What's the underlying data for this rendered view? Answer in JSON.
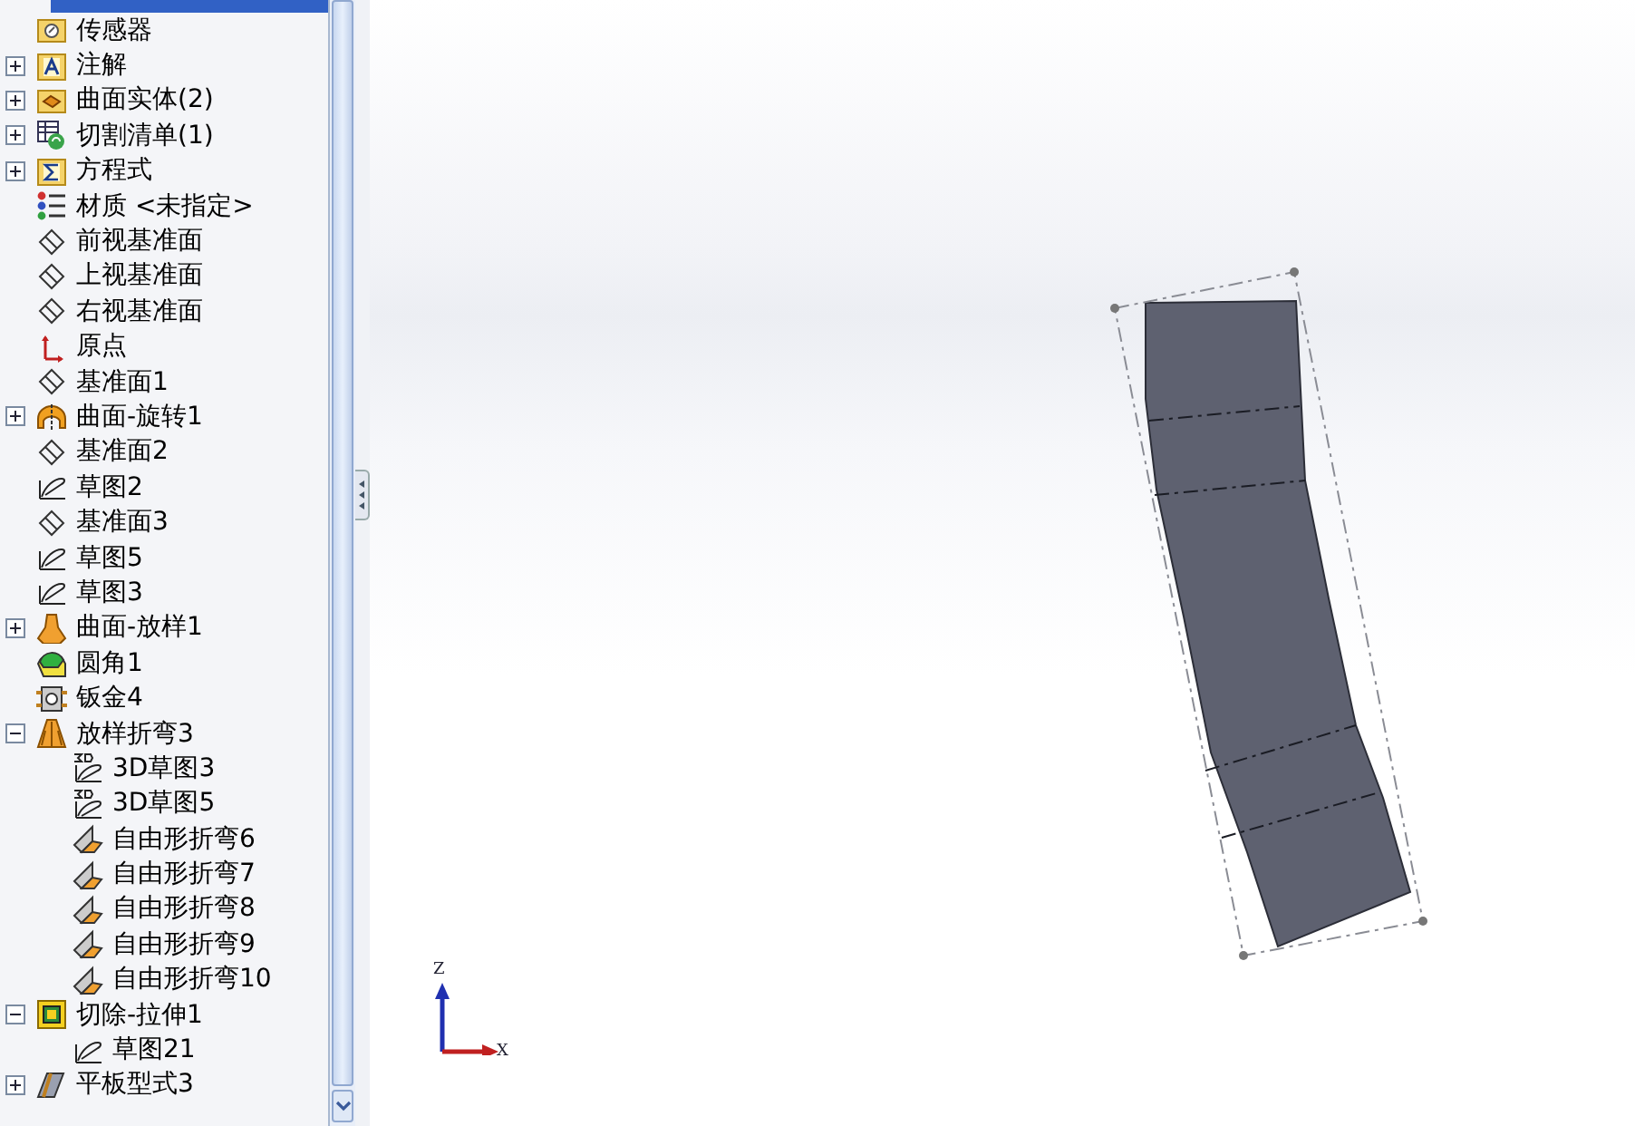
{
  "feature_tree": {
    "items": [
      {
        "label": "传感器",
        "kind": "sensor-folder"
      },
      {
        "label": "注解",
        "kind": "annotation-folder",
        "expanded": false
      },
      {
        "label": "曲面实体(2)",
        "kind": "body-folder",
        "expanded": false
      },
      {
        "label": "切割清单(1)",
        "kind": "cutlist",
        "expanded": false
      },
      {
        "label": "方程式",
        "kind": "equation-folder",
        "expanded": false
      },
      {
        "label": "材质 <未指定>",
        "kind": "material"
      },
      {
        "label": "前视基准面",
        "kind": "plane"
      },
      {
        "label": "上视基准面",
        "kind": "plane"
      },
      {
        "label": "右视基准面",
        "kind": "plane"
      },
      {
        "label": "原点",
        "kind": "origin"
      },
      {
        "label": "基准面1",
        "kind": "plane"
      },
      {
        "label": "曲面-旋转1",
        "kind": "revolve",
        "expanded": false
      },
      {
        "label": "基准面2",
        "kind": "plane"
      },
      {
        "label": "草图2",
        "kind": "sketch"
      },
      {
        "label": "基准面3",
        "kind": "plane"
      },
      {
        "label": "草图5",
        "kind": "sketch"
      },
      {
        "label": "草图3",
        "kind": "sketch"
      },
      {
        "label": "曲面-放样1",
        "kind": "loft",
        "expanded": false
      },
      {
        "label": "圆角1",
        "kind": "fillet"
      },
      {
        "label": "钣金4",
        "kind": "sheetmetal"
      },
      {
        "label": "放样折弯3",
        "kind": "loft-bend",
        "expanded": true,
        "children": [
          {
            "label": "3D草图3",
            "kind": "sketch3d"
          },
          {
            "label": "3D草图5",
            "kind": "sketch3d"
          },
          {
            "label": "自由形折弯6",
            "kind": "freebend"
          },
          {
            "label": "自由形折弯7",
            "kind": "freebend"
          },
          {
            "label": "自由形折弯8",
            "kind": "freebend"
          },
          {
            "label": "自由形折弯9",
            "kind": "freebend"
          },
          {
            "label": "自由形折弯10",
            "kind": "freebend"
          }
        ]
      },
      {
        "label": "切除-拉伸1",
        "kind": "cut-extrude",
        "expanded": true,
        "children": [
          {
            "label": "草图21",
            "kind": "sketch"
          }
        ]
      },
      {
        "label": "平板型式3",
        "kind": "flat-pattern",
        "expanded": false
      }
    ]
  },
  "triad": {
    "z_label": "Z",
    "x_label": "X"
  }
}
